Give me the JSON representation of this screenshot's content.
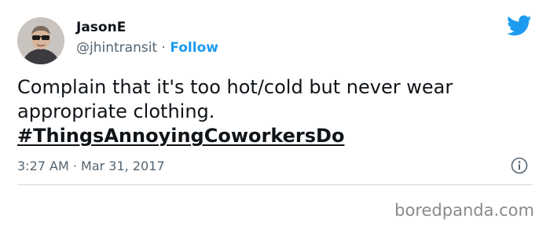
{
  "tweet": {
    "author": {
      "display_name": "JasonE",
      "handle": "@jhintransit",
      "separator": " · ",
      "follow_label": "Follow"
    },
    "text": "Complain that it's too hot/cold but never wear appropriate clothing.",
    "hashtag": "#ThingsAnnoyingCoworkersDo",
    "timestamp": "3:27 AM · Mar 31, 2017",
    "icons": {
      "platform": "twitter-bird-icon",
      "info": "info-icon"
    },
    "colors": {
      "accent": "#1d9bf0",
      "secondary_text": "#536471",
      "primary_text": "#0f1419"
    }
  },
  "watermark": "boredpanda.com"
}
